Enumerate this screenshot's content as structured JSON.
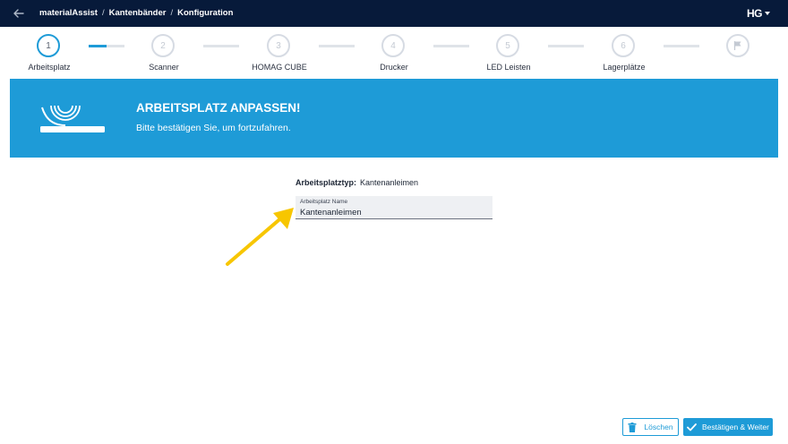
{
  "header": {
    "breadcrumbs": [
      "materialAssist",
      "Kantenbänder",
      "Konfiguration"
    ],
    "separator": "/",
    "logo_text": "HG"
  },
  "stepper": {
    "steps": [
      {
        "number": "1",
        "label": "Arbeitsplatz",
        "state": "active"
      },
      {
        "number": "2",
        "label": "Scanner",
        "state": "pending"
      },
      {
        "number": "3",
        "label": "HOMAG CUBE",
        "state": "pending"
      },
      {
        "number": "4",
        "label": "Drucker",
        "state": "pending"
      },
      {
        "number": "5",
        "label": "LED Leisten",
        "state": "pending"
      },
      {
        "number": "6",
        "label": "Lagerplätze",
        "state": "pending"
      }
    ],
    "final_icon": "flag-icon",
    "first_connector_progress": 0.5
  },
  "banner": {
    "title": "ARBEITSPLATZ ANPASSEN!",
    "subtitle": "Bitte bestätigen Sie, um fortzufahren."
  },
  "form": {
    "type_label": "Arbeitsplatztyp:",
    "type_value": "Kantenanleimen",
    "name_field": {
      "label": "Arbeitsplatz Name",
      "value": "Kantenanleimen"
    }
  },
  "actions": {
    "delete_label": "Löschen",
    "confirm_label": "Bestätigen & Weiter"
  },
  "colors": {
    "topbar": "#071a3a",
    "accent": "#1e9bd7",
    "annotation_arrow": "#f7c600"
  }
}
